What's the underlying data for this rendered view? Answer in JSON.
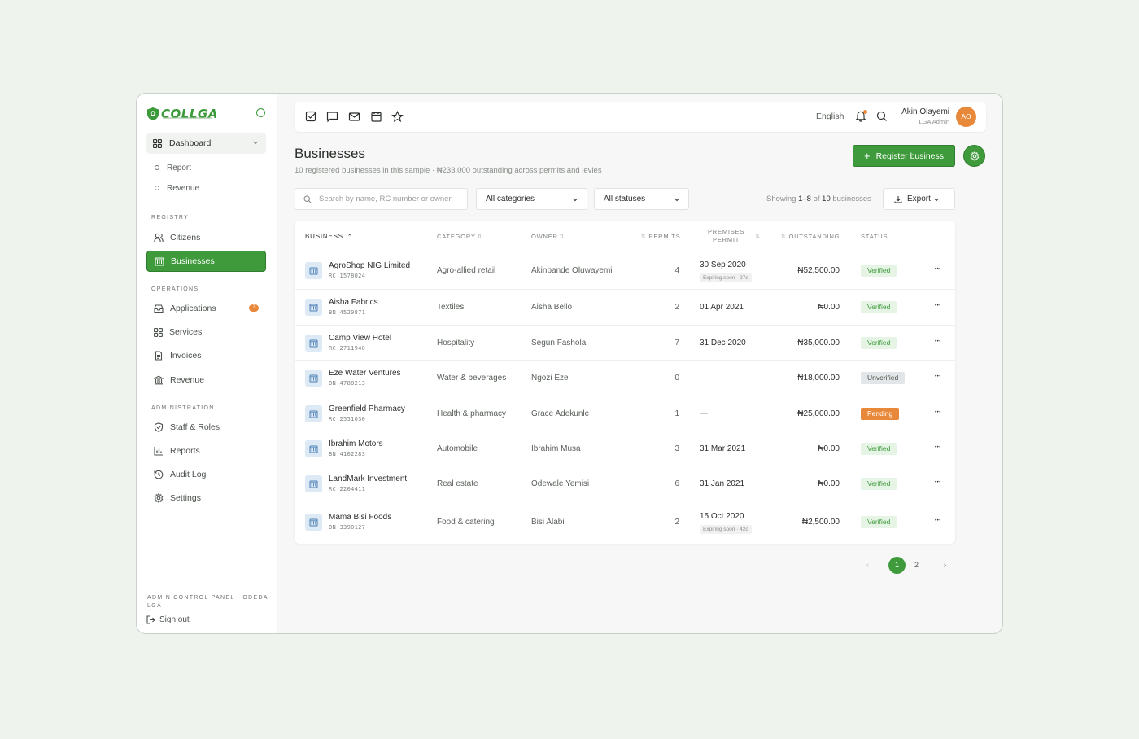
{
  "brand": {
    "name": "COLLGA"
  },
  "sidebar": {
    "dashboard_label": "Dashboard",
    "dashboard_sub": [
      "Report",
      "Revenue"
    ],
    "sections": {
      "registry": "REGISTRY",
      "operations": "OPERATIONS",
      "administration": "ADMINISTRATION"
    },
    "registry_items": [
      {
        "label": "Citizens",
        "icon": "users-icon"
      },
      {
        "label": "Businesses",
        "icon": "building-icon",
        "active": true
      }
    ],
    "operations_items": [
      {
        "label": "Applications",
        "icon": "inbox-icon",
        "badge": "7"
      },
      {
        "label": "Services",
        "icon": "grid-icon"
      },
      {
        "label": "Invoices",
        "icon": "document-icon"
      },
      {
        "label": "Revenue",
        "icon": "bank-icon"
      }
    ],
    "administration_items": [
      {
        "label": "Staff & Roles",
        "icon": "shield-check-icon"
      },
      {
        "label": "Reports",
        "icon": "bar-chart-icon"
      },
      {
        "label": "Audit Log",
        "icon": "history-icon"
      },
      {
        "label": "Settings",
        "icon": "gear-icon"
      }
    ],
    "footer_label": "ADMIN CONTROL PANEL · ODEDA LGA",
    "sign_out": "Sign out"
  },
  "topbar": {
    "language": "English",
    "user_name": "Akin Olayemi",
    "user_role": "LGA Admin",
    "user_initials": "AO"
  },
  "header": {
    "title": "Businesses",
    "subtitle": "10 registered businesses in this sample · ₦233,000 outstanding across permits and levies",
    "register_label": "Register business"
  },
  "filters": {
    "search_placeholder": "Search by name, RC number or owner",
    "category": "All categories",
    "status": "All statuses",
    "showing_prefix": "Showing",
    "showing_range": "1–8",
    "showing_of": "of",
    "showing_total": "10",
    "showing_suffix": "businesses",
    "export_label": "Export"
  },
  "table": {
    "headers": {
      "business": "BUSINESS",
      "category": "CATEGORY",
      "owner": "OWNER",
      "permits": "PERMITS",
      "premises_1": "PREMISES",
      "premises_2": "PERMIT",
      "outstanding": "OUTSTANDING",
      "status": "STATUS"
    },
    "rows": [
      {
        "name": "AgroShop NIG Limited",
        "reg": "RC 1578024",
        "category": "Agro-allied retail",
        "owner": "Akinbande Oluwayemi",
        "permits": "4",
        "premises": "30 Sep 2020",
        "expiring": "Expiring soon · 27d",
        "outstanding": "₦52,500.00",
        "status": "Verified"
      },
      {
        "name": "Aisha Fabrics",
        "reg": "BN 4520871",
        "category": "Textiles",
        "owner": "Aisha Bello",
        "permits": "2",
        "premises": "01 Apr 2021",
        "expiring": "",
        "outstanding": "₦0.00",
        "status": "Verified"
      },
      {
        "name": "Camp View Hotel",
        "reg": "RC 2711940",
        "category": "Hospitality",
        "owner": "Segun Fashola",
        "permits": "7",
        "premises": "31 Dec 2020",
        "expiring": "",
        "outstanding": "₦35,000.00",
        "status": "Verified"
      },
      {
        "name": "Eze Water Ventures",
        "reg": "BN 4788213",
        "category": "Water & beverages",
        "owner": "Ngozi Eze",
        "permits": "0",
        "premises": "—",
        "expiring": "",
        "outstanding": "₦18,000.00",
        "status": "Unverified"
      },
      {
        "name": "Greenfield Pharmacy",
        "reg": "RC 2551030",
        "category": "Health & pharmacy",
        "owner": "Grace Adekunle",
        "permits": "1",
        "premises": "—",
        "expiring": "",
        "outstanding": "₦25,000.00",
        "status": "Pending"
      },
      {
        "name": "Ibrahim Motors",
        "reg": "BN 4102283",
        "category": "Automobile",
        "owner": "Ibrahim Musa",
        "permits": "3",
        "premises": "31 Mar 2021",
        "expiring": "",
        "outstanding": "₦0.00",
        "status": "Verified"
      },
      {
        "name": "LandMark Investment",
        "reg": "RC 2204411",
        "category": "Real estate",
        "owner": "Odewale Yemisi",
        "permits": "6",
        "premises": "31 Jan 2021",
        "expiring": "",
        "outstanding": "₦0.00",
        "status": "Verified"
      },
      {
        "name": "Mama Bisi Foods",
        "reg": "BN 3390127",
        "category": "Food & catering",
        "owner": "Bisi Alabi",
        "permits": "2",
        "premises": "15 Oct 2020",
        "expiring": "Expiring soon · 42d",
        "outstanding": "₦2,500.00",
        "status": "Verified"
      }
    ]
  },
  "pagination": {
    "prev": "‹",
    "pages": [
      "1",
      "2"
    ],
    "next": "›",
    "current": "1"
  },
  "colors": {
    "accent": "#3e9a3b",
    "warning": "#e8883a",
    "background": "#eef3ee"
  }
}
